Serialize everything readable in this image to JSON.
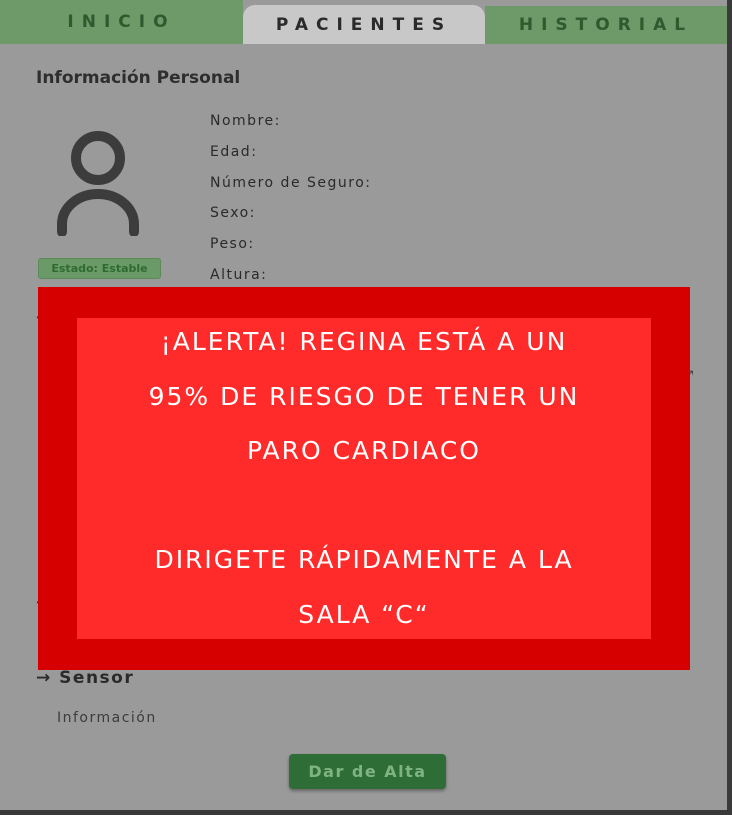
{
  "tabs": [
    {
      "label": "INICIO",
      "active": false
    },
    {
      "label": "PACIENTES",
      "active": true
    },
    {
      "label": "HISTORIAL",
      "active": false
    }
  ],
  "personal_info": {
    "title": "Información Personal",
    "status_badge": "Estado: Estable",
    "fields": [
      "Nombre:",
      "Edad:",
      "Número de Seguro:",
      "Sexo:",
      "Peso:",
      "Altura:"
    ]
  },
  "sensor": {
    "heading": "Sensor",
    "info": "Información"
  },
  "discharge_button": "Dar de Alta",
  "alert": {
    "lines": [
      "¡ALERTA! REGINA ESTÁ A UN",
      "95% DE RIESGO DE TENER UN",
      "PARO CARDIACO",
      "",
      "DIRIGETE RÁPIDAMENTE A LA",
      "SALA “C“"
    ]
  },
  "colors": {
    "tab_inactive": "#6e9a6a",
    "tab_active": "#c8c8c8",
    "alert_outer": "#d70000",
    "alert_inner": "#ff2b2b",
    "button_bg": "#2e6e36",
    "status_badge_text": "#2f6b2f"
  },
  "icons": {
    "avatar": "user-avatar-icon",
    "arrow": "right-arrow-icon",
    "expand": "expand-icon"
  }
}
